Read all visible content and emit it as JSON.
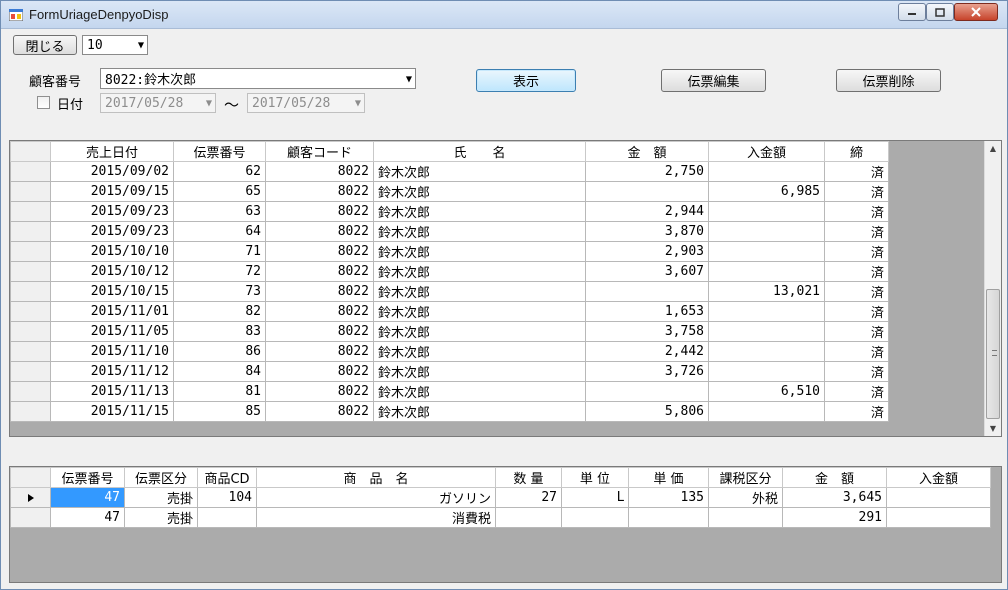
{
  "window": {
    "title": "FormUriageDenpyoDisp"
  },
  "toolbar": {
    "close_label": "閉じる",
    "count_value": "10"
  },
  "filters": {
    "customer_label": "顧客番号",
    "customer_value": "8022:鈴木次郎",
    "date_label": "日付",
    "date_from": "2017/05/28",
    "date_to": "2017/05/28",
    "tilde": "〜"
  },
  "actions": {
    "show_label": "表示",
    "edit_label": "伝票編集",
    "delete_label": "伝票削除"
  },
  "header_grid": {
    "columns": [
      "売上日付",
      "伝票番号",
      "顧客コード",
      "氏　　名",
      "金　額",
      "入金額",
      "締"
    ],
    "rows": [
      [
        "2015/09/02",
        "62",
        "8022",
        "鈴木次郎",
        "2,750",
        "",
        "済"
      ],
      [
        "2015/09/15",
        "65",
        "8022",
        "鈴木次郎",
        "",
        "6,985",
        "済"
      ],
      [
        "2015/09/23",
        "63",
        "8022",
        "鈴木次郎",
        "2,944",
        "",
        "済"
      ],
      [
        "2015/09/23",
        "64",
        "8022",
        "鈴木次郎",
        "3,870",
        "",
        "済"
      ],
      [
        "2015/10/10",
        "71",
        "8022",
        "鈴木次郎",
        "2,903",
        "",
        "済"
      ],
      [
        "2015/10/12",
        "72",
        "8022",
        "鈴木次郎",
        "3,607",
        "",
        "済"
      ],
      [
        "2015/10/15",
        "73",
        "8022",
        "鈴木次郎",
        "",
        "13,021",
        "済"
      ],
      [
        "2015/11/01",
        "82",
        "8022",
        "鈴木次郎",
        "1,653",
        "",
        "済"
      ],
      [
        "2015/11/05",
        "83",
        "8022",
        "鈴木次郎",
        "3,758",
        "",
        "済"
      ],
      [
        "2015/11/10",
        "86",
        "8022",
        "鈴木次郎",
        "2,442",
        "",
        "済"
      ],
      [
        "2015/11/12",
        "84",
        "8022",
        "鈴木次郎",
        "3,726",
        "",
        "済"
      ],
      [
        "2015/11/13",
        "81",
        "8022",
        "鈴木次郎",
        "",
        "6,510",
        "済"
      ],
      [
        "2015/11/15",
        "85",
        "8022",
        "鈴木次郎",
        "5,806",
        "",
        "済"
      ]
    ]
  },
  "detail_grid": {
    "columns": [
      "伝票番号",
      "伝票区分",
      "商品CD",
      "商　品　名",
      "数 量",
      "単 位",
      "単 価",
      "課税区分",
      "金　額",
      "入金額"
    ],
    "rows": [
      [
        "47",
        "売掛",
        "104",
        "ガソリン",
        "27",
        "L",
        "135",
        "外税",
        "3,645",
        ""
      ],
      [
        "47",
        "売掛",
        "",
        "消費税",
        "",
        "",
        "",
        "",
        "291",
        ""
      ]
    ]
  },
  "colors": {
    "selection": "#3399ff",
    "grid_background": "#ababab"
  }
}
